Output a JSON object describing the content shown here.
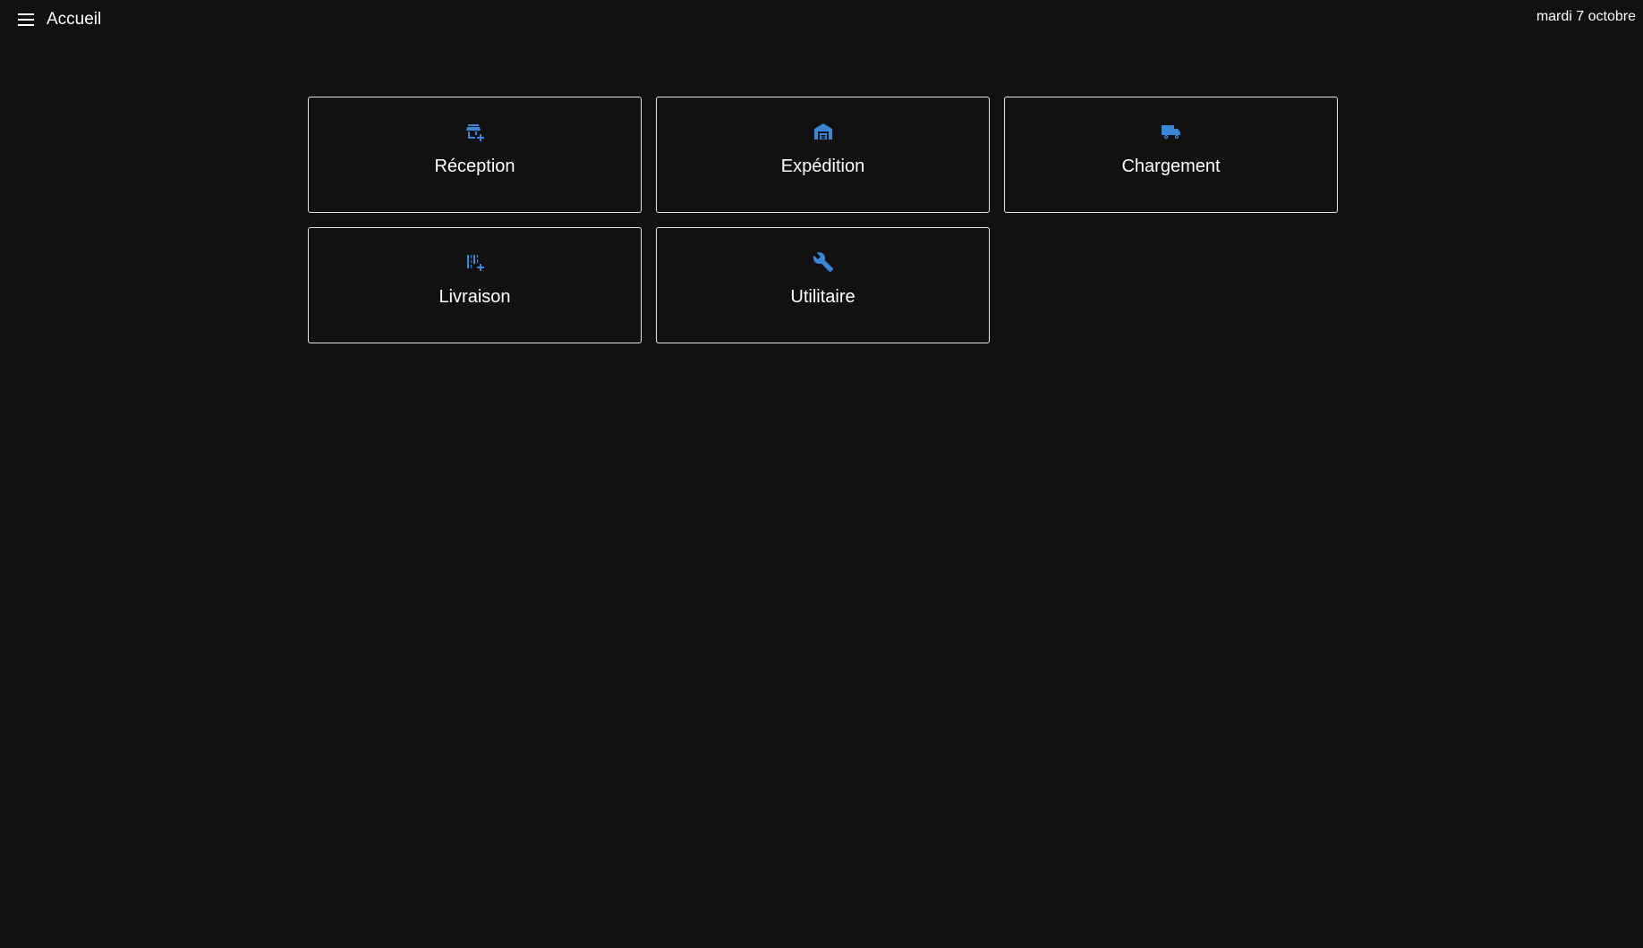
{
  "header": {
    "menu_icon": "menu-icon",
    "title": "Accueil",
    "date": "mardi 7 octobre"
  },
  "accent_color": "#3a86d9",
  "tiles": [
    {
      "label": "Réception",
      "icon": "store-plus-icon"
    },
    {
      "label": "Expédition",
      "icon": "warehouse-icon"
    },
    {
      "label": "Chargement",
      "icon": "truck-icon"
    },
    {
      "label": "Livraison",
      "icon": "barcode-plus-icon"
    },
    {
      "label": "Utilitaire",
      "icon": "wrench-icon"
    }
  ]
}
